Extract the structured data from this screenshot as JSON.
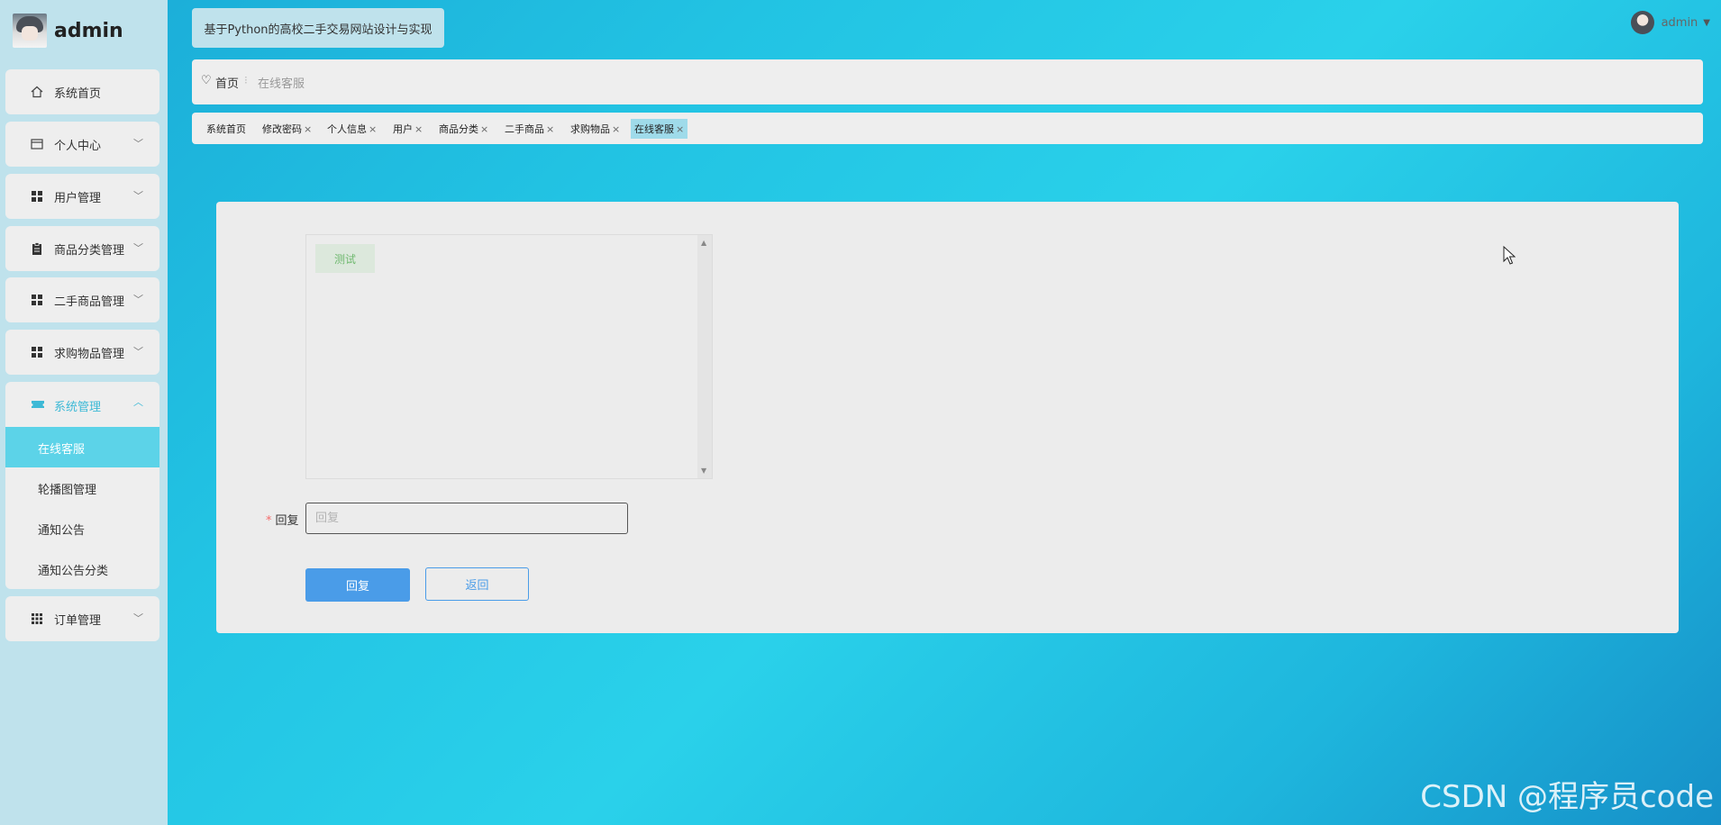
{
  "sidebar": {
    "brand": "admin",
    "items": [
      {
        "label": "系统首页",
        "icon": "home-icon",
        "chevron": ""
      },
      {
        "label": "个人中心",
        "icon": "card-icon",
        "chevron": "﹀"
      },
      {
        "label": "用户管理",
        "icon": "grid-icon",
        "chevron": "﹀"
      },
      {
        "label": "商品分类管理",
        "icon": "clipboard-icon",
        "chevron": "﹀"
      },
      {
        "label": "二手商品管理",
        "icon": "grid-icon",
        "chevron": "﹀"
      },
      {
        "label": "求购物品管理",
        "icon": "grid-icon",
        "chevron": "﹀"
      }
    ],
    "system": {
      "label": "系统管理",
      "icon": "ticket-icon",
      "chevron": "︿",
      "subs": [
        {
          "label": "在线客服",
          "active": true
        },
        {
          "label": "轮播图管理",
          "active": false
        },
        {
          "label": "通知公告",
          "active": false
        },
        {
          "label": "通知公告分类",
          "active": false
        }
      ]
    },
    "order": {
      "label": "订单管理",
      "icon": "apps-icon",
      "chevron": "﹀"
    }
  },
  "header": {
    "title": "基于Python的高校二手交易网站设计与实现",
    "user": "admin"
  },
  "breadcrumb": {
    "home": "首页",
    "separator": "⁝",
    "current": "在线客服"
  },
  "tags": [
    {
      "label": "系统首页",
      "closable": false
    },
    {
      "label": "修改密码",
      "closable": true
    },
    {
      "label": "个人信息",
      "closable": true
    },
    {
      "label": "用户",
      "closable": true
    },
    {
      "label": "商品分类",
      "closable": true
    },
    {
      "label": "二手商品",
      "closable": true
    },
    {
      "label": "求购物品",
      "closable": true
    },
    {
      "label": "在线客服",
      "closable": true,
      "active": true
    }
  ],
  "chat": {
    "messages": [
      {
        "text": "测试"
      }
    ]
  },
  "form": {
    "reply_label": "回复",
    "required_mark": "*",
    "reply_placeholder": "回复",
    "reply_value": "",
    "submit_label": "回复",
    "back_label": "返回"
  },
  "watermark": "CSDN @程序员code",
  "colors": {
    "accent": "#5cd3e8",
    "primary_button": "#4a9ce8",
    "sidebar_bg": "#bfe2ec"
  }
}
